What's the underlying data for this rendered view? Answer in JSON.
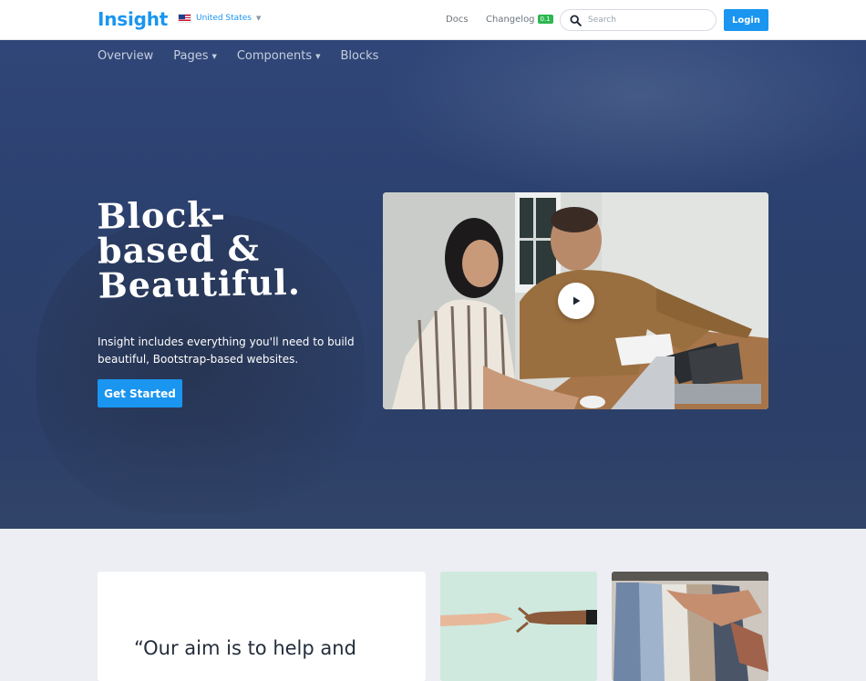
{
  "header": {
    "brand": "Insight",
    "locale": "United States",
    "links": {
      "docs": "Docs",
      "changelog": "Changelog",
      "changelog_badge": "0.1"
    },
    "search": {
      "placeholder": "Search",
      "value": ""
    },
    "login": "Login"
  },
  "subnav": {
    "items": [
      {
        "label": "Overview",
        "dropdown": false
      },
      {
        "label": "Pages",
        "dropdown": true
      },
      {
        "label": "Components",
        "dropdown": true
      },
      {
        "label": "Blocks",
        "dropdown": false
      }
    ]
  },
  "hero": {
    "title_lines": [
      "Block-",
      "based &",
      "Beautiful."
    ],
    "lead": "Insight includes everything you'll need to build beautiful, Bootstrap-based websites.",
    "cta": "Get Started"
  },
  "section2": {
    "quote": "“Our aim is to help and"
  },
  "colors": {
    "accent": "#1a95f0",
    "hero_bg": "#2c416f",
    "badge": "#2db750",
    "page_bg": "#eceef3"
  },
  "icons": {
    "search": "search-icon",
    "flag": "us-flag-icon",
    "play": "play-icon",
    "caret": "caret-down-icon"
  }
}
